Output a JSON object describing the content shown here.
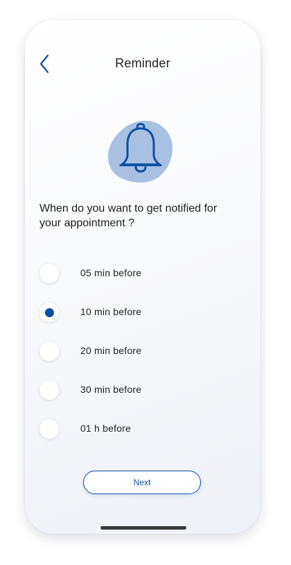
{
  "header": {
    "title": "Reminder",
    "back_icon": "chevron-left-icon"
  },
  "illustration": {
    "icon": "bell-icon",
    "blob_color": "#a8c0e2",
    "stroke_color": "#0a4fa0"
  },
  "question": "When do you want to get notified for your appointment ?",
  "options": [
    {
      "label": "05 min before",
      "selected": false
    },
    {
      "label": "10 min before",
      "selected": true
    },
    {
      "label": "20 min before",
      "selected": false
    },
    {
      "label": "30 min before",
      "selected": false
    },
    {
      "label": "01 h before",
      "selected": false
    }
  ],
  "next_button": {
    "label": "Next"
  },
  "colors": {
    "accent": "#0a4fa0",
    "text": "#1f1f1f"
  }
}
